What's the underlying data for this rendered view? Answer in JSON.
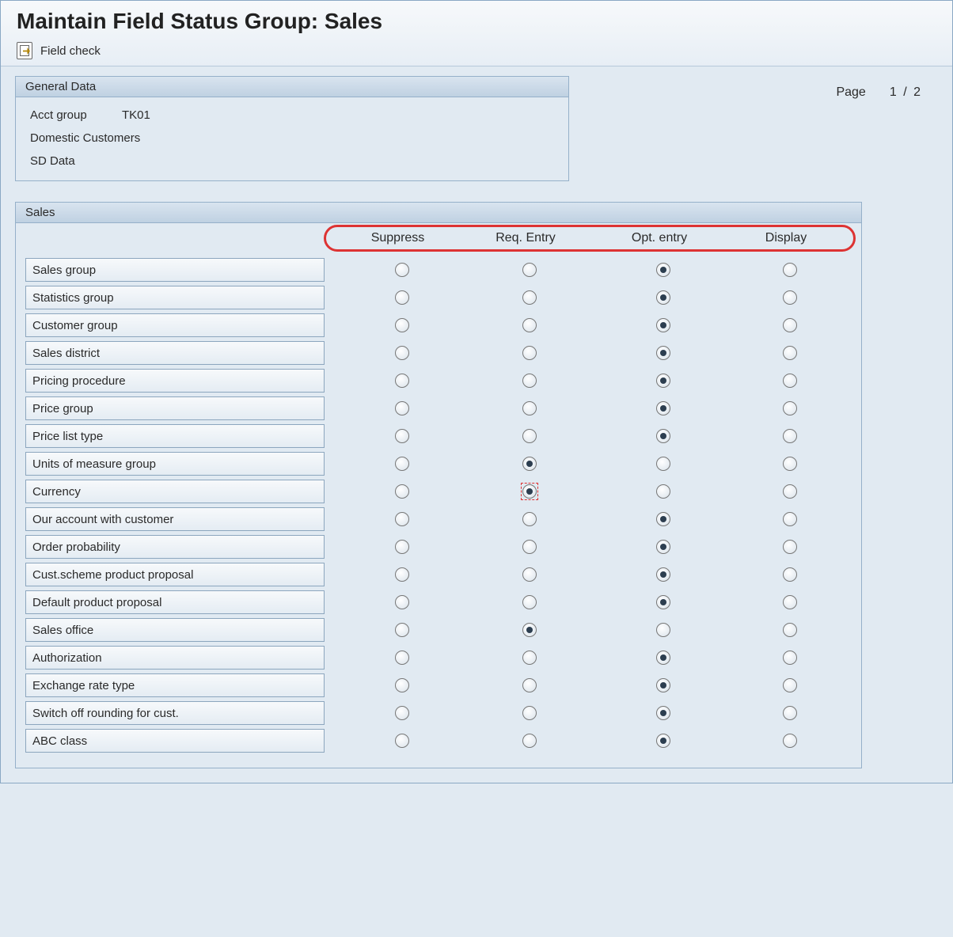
{
  "title": "Maintain Field Status Group: Sales",
  "toolbar": {
    "field_check_label": "Field check"
  },
  "general": {
    "header": "General Data",
    "acct_label": "Acct group",
    "acct_value": "TK01",
    "desc": "Domestic Customers",
    "sd": "SD Data"
  },
  "page": {
    "label": "Page",
    "current": "1",
    "sep": "/",
    "total": "2"
  },
  "sales": {
    "header": "Sales",
    "columns": [
      "Suppress",
      "Req. Entry",
      "Opt. entry",
      "Display"
    ],
    "rows": [
      {
        "label": "Sales group",
        "selected": 2
      },
      {
        "label": "Statistics group",
        "selected": 2
      },
      {
        "label": "Customer group",
        "selected": 2
      },
      {
        "label": "Sales district",
        "selected": 2
      },
      {
        "label": "Pricing procedure",
        "selected": 2
      },
      {
        "label": "Price group",
        "selected": 2
      },
      {
        "label": "Price list type",
        "selected": 2
      },
      {
        "label": "Units of measure group",
        "selected": 1
      },
      {
        "label": "Currency",
        "selected": 1,
        "focus": true
      },
      {
        "label": "Our account with customer",
        "selected": 2
      },
      {
        "label": "Order probability",
        "selected": 2
      },
      {
        "label": "Cust.scheme product proposal",
        "selected": 2
      },
      {
        "label": "Default product proposal",
        "selected": 2
      },
      {
        "label": "Sales office",
        "selected": 1
      },
      {
        "label": "Authorization",
        "selected": 2
      },
      {
        "label": "Exchange rate type",
        "selected": 2
      },
      {
        "label": "Switch off rounding for cust.",
        "selected": 2
      },
      {
        "label": "ABC class",
        "selected": 2
      }
    ]
  }
}
